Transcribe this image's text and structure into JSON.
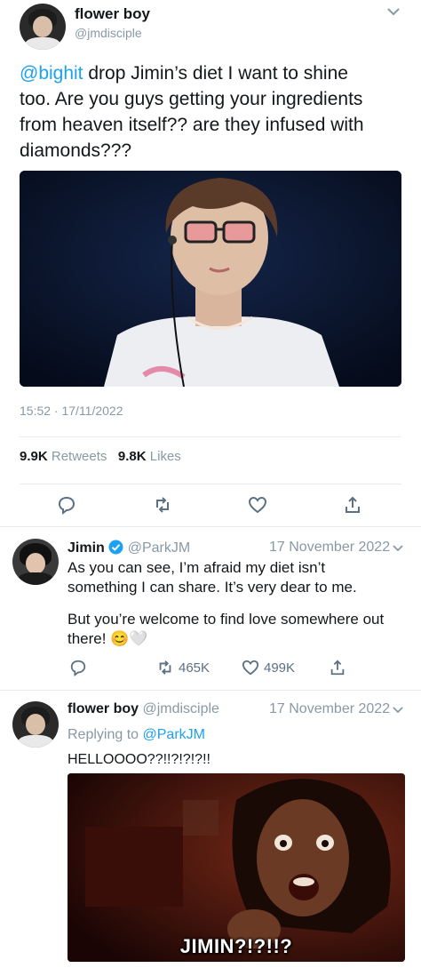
{
  "main_tweet": {
    "display_name": "flower boy",
    "handle": "@jmdisciple",
    "mention": "@bighit",
    "text_line1": " drop Jimin’s diet I want to shine",
    "text_line2": "too. Are you guys getting your ingredients",
    "text_line3": "from heaven itself?? are they infused with",
    "text_line4": "diamonds???",
    "timestamp": "15:52 · 17/11/2022",
    "retweets_count": "9.9K",
    "retweets_label": "Retweets",
    "likes_count": "9.8K",
    "likes_label": "Likes"
  },
  "reply1": {
    "display_name": "Jimin",
    "handle": "@ParkJM",
    "date": "17 November 2022",
    "line1": "As you can see, I’m afraid my diet isn’t",
    "line2": "something I can share. It’s very dear to me.",
    "line3": "But you’re welcome to find love somewhere out",
    "line4": "there! 😊🤍",
    "retweets": "465K",
    "likes": "499K"
  },
  "reply2": {
    "display_name": "flower boy",
    "handle": "@jmdisciple",
    "date": "17 November 2022",
    "replying_prefix": "Replying to ",
    "replying_to": "@ParkJM",
    "text": "HELLOOOO??!!?!?!?!!",
    "meme_caption": "JIMIN?!?!!?"
  },
  "colors": {
    "link": "#1da1f2",
    "muted": "#8899a6",
    "divider": "#e6ecf0",
    "verified": "#1da1f2"
  }
}
